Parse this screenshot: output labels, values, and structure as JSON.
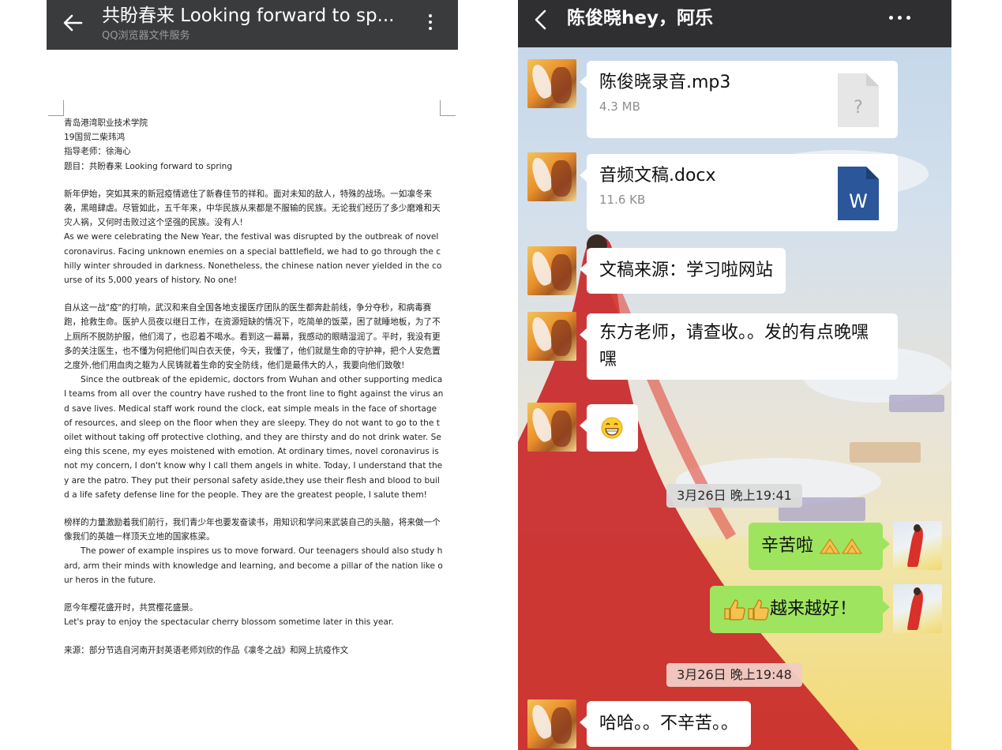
{
  "left": {
    "title": "共盼春来 Looking forward to sp...",
    "subtitle": "QQ浏览器文件服务",
    "doc": {
      "header": [
        "青岛港湾职业技术学院",
        "19国贸二柴玮鸿",
        "指导老师：徐海心",
        "题目：共盼春来  Looking forward to spring"
      ],
      "p1_cn": "新年伊始，突如其来的新冠疫情遮住了新春佳节的祥和。面对未知的敌人，特殊的战场。一如凛冬来袭，黑暗肆虐。尽管如此，五千年来，中华民族从来都是不服输的民族。无论我们经历了多少磨难和天灾人祸，又何时击败过这个坚强的民族。没有人!",
      "p1_en": "As we were celebrating the New Year, the festival was disrupted by the outbreak of novel coronavirus. Facing unknown enemies on a special battlefield, we had to go through the chilly winter shrouded in darkness. Nonetheless, the chinese nation never yielded in the course of its 5,000 years of history. No one!",
      "p2_cn": "自从这一战\"疫\"的打响，武汉和来自全国各地支援医疗团队的医生都奔赴前线，争分夺秒，和病毒赛跑，抢救生命。医护人员夜以继日工作，在资源短缺的情况下，吃简单的饭菜，困了就睡地板，为了不上厕所不脱防护服，他们渴了，也忍着不喝水。看到这一幕幕，我感动的眼睛湿润了。平时，我没有更多的关注医生，也不懂为何把他们叫白衣天使，今天，我懂了，他们就是生命的守护神，把个人安危置之度外,他们用血肉之躯为人民铸就着生命的安全防线，他们是最伟大的人，我要向他们致敬!",
      "p2_en": "Since the outbreak of the epidemic, doctors from Wuhan and other supporting medical teams from all over the country have rushed to the front line to fight against the virus and save lives. Medical staff work round the clock, eat simple meals in the face of shortage of resources, and sleep on the floor when they are sleepy. They do not want to go to the toilet without taking off protective clothing, and they are thirsty and do not drink water. Seeing this scene, my eyes moistened with emotion. At ordinary times, novel coronavirus is not my concern, I don't know why I call them angels in white. Today, I understand that they are the patro. They put their personal safety aside,they use their flesh and blood to build a life safety defense line for the people. They are the greatest people, I salute them!",
      "p3_cn": "榜样的力量激励着我们前行，我们青少年也要发奋读书，用知识和学问来武装自己的头脑，将来做一个像我们的英雄一样顶天立地的国家栋梁。",
      "p3_en": "The power of example inspires us to move forward. Our teenagers should also study hard, arm their minds with knowledge and learning, and become a pillar of the nation like our heros in the future.",
      "p4_cn": "愿今年樱花盛开时，共赏樱花盛景。",
      "p4_en": "Let's pray to enjoy the spectacular cherry blossom sometime later in this year.",
      "source": "来源：部分节选自河南开封英语老师刘欣的作品《凛冬之战》和网上抗疫作文"
    }
  },
  "right": {
    "title": "陈俊晓hey，阿乐",
    "messages": {
      "m1": {
        "name": "陈俊晓录音.mp3",
        "size": "4.3 MB",
        "icon": "unknown-file-icon",
        "icon_glyph": "?"
      },
      "m2": {
        "name": "音频文稿.docx",
        "size": "11.6 KB",
        "icon": "word-file-icon",
        "icon_glyph": "W"
      },
      "m3": "文稿来源：学习啦网站",
      "m4": "东方老师，请查收。。发的有点晚嘿嘿",
      "m5_emoji": "grin-emoji",
      "t1": "3月26日 晚上19:41",
      "m6": "辛苦啦",
      "m6_emoji": "hands-together-emoji",
      "m7": "越来越好！",
      "m7_emoji": "thumbs-up-emoji",
      "t2": "3月26日 晚上19:48",
      "m8": "哈哈。。不辛苦。。"
    },
    "colors": {
      "bubble_out": "#9ee45f",
      "bubble_in": "#ffffff",
      "word_blue": "#2b579a",
      "bar": "#2f2f31"
    }
  }
}
